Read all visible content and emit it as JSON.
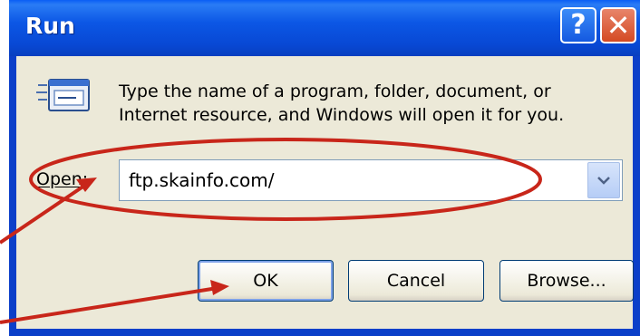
{
  "window": {
    "title": "Run",
    "help_glyph": "?",
    "close_glyph": "✕"
  },
  "dialog": {
    "icon": "run-icon",
    "description_line1": "Type the name of a program, folder, document, or",
    "description_line2": "Internet resource, and Windows will open it for you.",
    "open_label": "Open:",
    "open_value": "ftp.skainfo.com/",
    "ok_label": "OK",
    "cancel_label": "Cancel",
    "browse_label": "Browse..."
  },
  "colors": {
    "titlebar": "#0a5ef5",
    "client_bg": "#ece9d8",
    "annotation": "#c8261a"
  }
}
